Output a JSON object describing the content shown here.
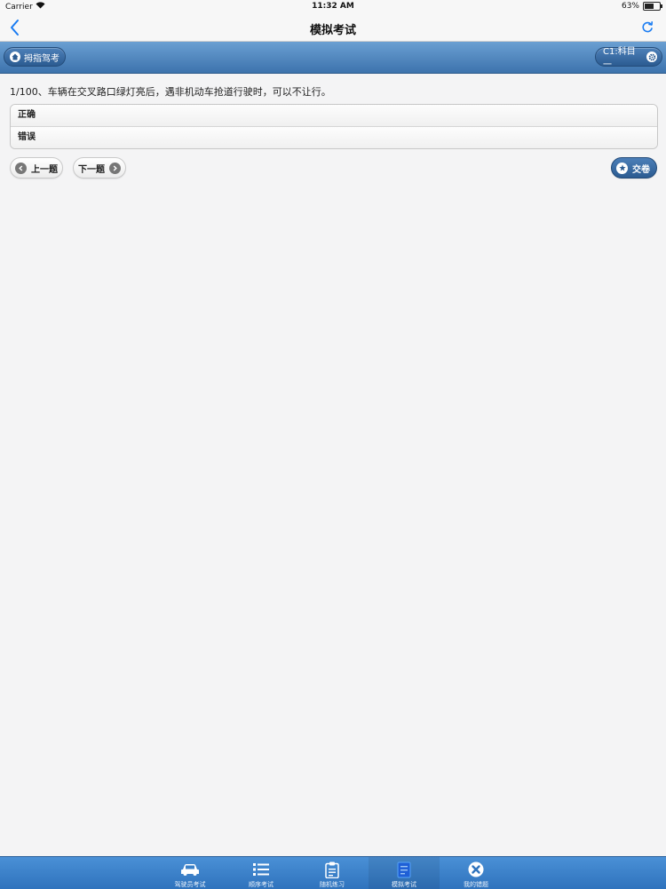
{
  "status_bar": {
    "carrier": "Carrier",
    "time": "11:32 AM",
    "battery": "63%",
    "battery_level": 0.63
  },
  "nav": {
    "title": "模拟考试"
  },
  "toolbar": {
    "home_label": "拇指驾考",
    "level_label": "C1:科目一"
  },
  "question": {
    "text": "1/100、车辆在交叉路口绿灯亮后，遇非机动车抢道行驶时，可以不让行。",
    "options": [
      "正确",
      "错误"
    ]
  },
  "buttons": {
    "prev": "上一题",
    "next": "下一题",
    "submit": "交卷"
  },
  "tabs": [
    {
      "label": "驾驶员考试",
      "icon": "car-icon"
    },
    {
      "label": "顺序考试",
      "icon": "list-icon"
    },
    {
      "label": "随机练习",
      "icon": "clipboard-icon"
    },
    {
      "label": "模拟考试",
      "icon": "exam-icon",
      "active": true
    },
    {
      "label": "我的错题",
      "icon": "close-circle-icon"
    }
  ],
  "colors": {
    "accent": "#3d73ad",
    "tabbar": "#2f73bd",
    "ios_blue": "#1a7cf2"
  }
}
